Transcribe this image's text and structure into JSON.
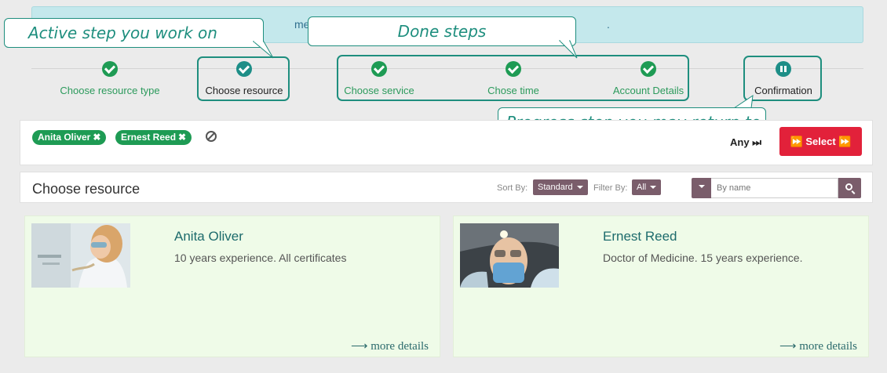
{
  "notice": {
    "text_fragment": "ments.",
    "text_end": "."
  },
  "steps": [
    {
      "label": "Choose resource type",
      "state": "done"
    },
    {
      "label": "Choose resource",
      "state": "active"
    },
    {
      "label": "Choose service",
      "state": "done"
    },
    {
      "label": "Chose time",
      "state": "done"
    },
    {
      "label": "Account Details",
      "state": "done"
    },
    {
      "label": "Confirmation",
      "state": "progress"
    }
  ],
  "callouts": {
    "active": "Active step you work on",
    "done": "Done steps",
    "progress": "Progress step you may return to"
  },
  "filters": {
    "tags": [
      "Anita Oliver",
      "Ernest Reed"
    ],
    "any_label": "Any",
    "select_label": "Select"
  },
  "toolbar": {
    "title": "Choose resource",
    "sort_label": "Sort By:",
    "sort_value": "Standard",
    "filter_label": "Filter By:",
    "filter_value": "All",
    "search_placeholder": "By name"
  },
  "resources": [
    {
      "name": "Anita Oliver",
      "description": "10 years experience. All certificates",
      "more": "more details"
    },
    {
      "name": "Ernest Reed",
      "description": "Doctor of Medicine. 15 years experience.",
      "more": "more details"
    }
  ],
  "colors": {
    "done": "#1e9b54",
    "accent": "#1e8e7e",
    "select_button": "#e2213a",
    "dropdown": "#7a5d6b",
    "card_bg": "#effbe8"
  }
}
